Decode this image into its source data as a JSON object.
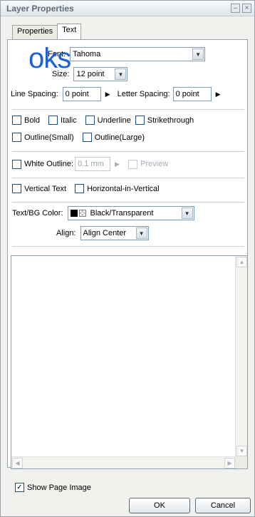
{
  "window": {
    "title": "Layer Properties",
    "minimize_glyph": "–",
    "close_glyph": "×"
  },
  "tabs": [
    {
      "label": "Properties"
    },
    {
      "label": "Text"
    }
  ],
  "overlay_text": "oks",
  "font": {
    "label": "Font:",
    "value": "Tahoma"
  },
  "size": {
    "label": "Size:",
    "value": "12 point"
  },
  "line_spacing": {
    "label": "Line Spacing:",
    "value": "0 point"
  },
  "letter_spacing": {
    "label": "Letter Spacing:",
    "value": "0 point"
  },
  "styles": [
    {
      "label": "Bold",
      "checked": false
    },
    {
      "label": "Italic",
      "checked": false
    },
    {
      "label": "Underline",
      "checked": false
    },
    {
      "label": "Strikethrough",
      "checked": false
    },
    {
      "label": "Outline(Small)",
      "checked": false
    },
    {
      "label": "Outline(Large)",
      "checked": false
    }
  ],
  "white_outline": {
    "label": "White Outline:",
    "value": "0.1 mm",
    "preview_label": "Preview"
  },
  "vertical": {
    "vertical_text": "Vertical Text",
    "horizontal_in_vertical": "Horizontal-in-Vertical"
  },
  "text_bg_color": {
    "label": "Text/BG Color:",
    "value": "Black/Transparent"
  },
  "align": {
    "label": "Align:",
    "value": "Align Center"
  },
  "text_content": "",
  "show_page_image": {
    "label": "Show Page Image",
    "checked": true
  },
  "buttons": {
    "ok": "OK",
    "cancel": "Cancel"
  }
}
